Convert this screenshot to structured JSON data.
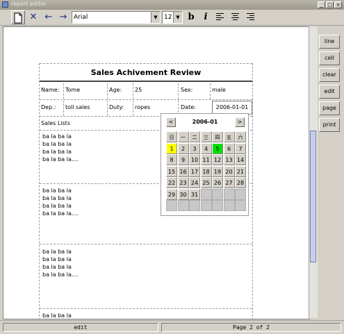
{
  "window": {
    "title": "report editor"
  },
  "toolbar": {
    "font_name": "Arial",
    "font_size": "12",
    "bold_label": "b",
    "italic_label": "i"
  },
  "report": {
    "title": "Sales Achivement Review",
    "name_label": "Name:",
    "name_value": "Tome",
    "age_label": "Age:",
    "age_value": "25",
    "sex_label": "Sex:",
    "sex_value": "male",
    "dep_label": "Dep.:",
    "dep_value": "toll sales",
    "duty_label": "Duty:",
    "duty_value": "ropes",
    "date_label": "Date:",
    "date_value": "2006-01-01",
    "sales_lists_label": "Sales Lists",
    "list_lines": [
      "ba la ba la",
      "ba la ba la",
      "ba la ba la",
      "ba la ba la...."
    ],
    "last_line": "ba la ba la"
  },
  "calendar": {
    "month_label": "2006-01",
    "prev": "<",
    "next": ">",
    "weekdays": [
      "日",
      "一",
      "二",
      "三",
      "四",
      "五",
      "六"
    ],
    "days": [
      [
        "1",
        "2",
        "3",
        "4",
        "5",
        "6",
        "7"
      ],
      [
        "8",
        "9",
        "10",
        "11",
        "12",
        "13",
        "14"
      ],
      [
        "15",
        "16",
        "17",
        "18",
        "19",
        "20",
        "21"
      ],
      [
        "22",
        "23",
        "24",
        "25",
        "26",
        "27",
        "28"
      ],
      [
        "29",
        "30",
        "31",
        "",
        "",
        "",
        ""
      ],
      [
        "",
        "",
        "",
        "",
        "",
        "",
        ""
      ]
    ],
    "selected_day": "1",
    "today_day": "5",
    "selected_color": "#ffff00",
    "today_color": "#00e000"
  },
  "side_buttons": {
    "line": "line",
    "cell": "cell",
    "clear": "clear",
    "edit": "edit",
    "page": "page",
    "print": "print"
  },
  "status": {
    "mode": "edit",
    "page": "Page 2 of 2"
  }
}
